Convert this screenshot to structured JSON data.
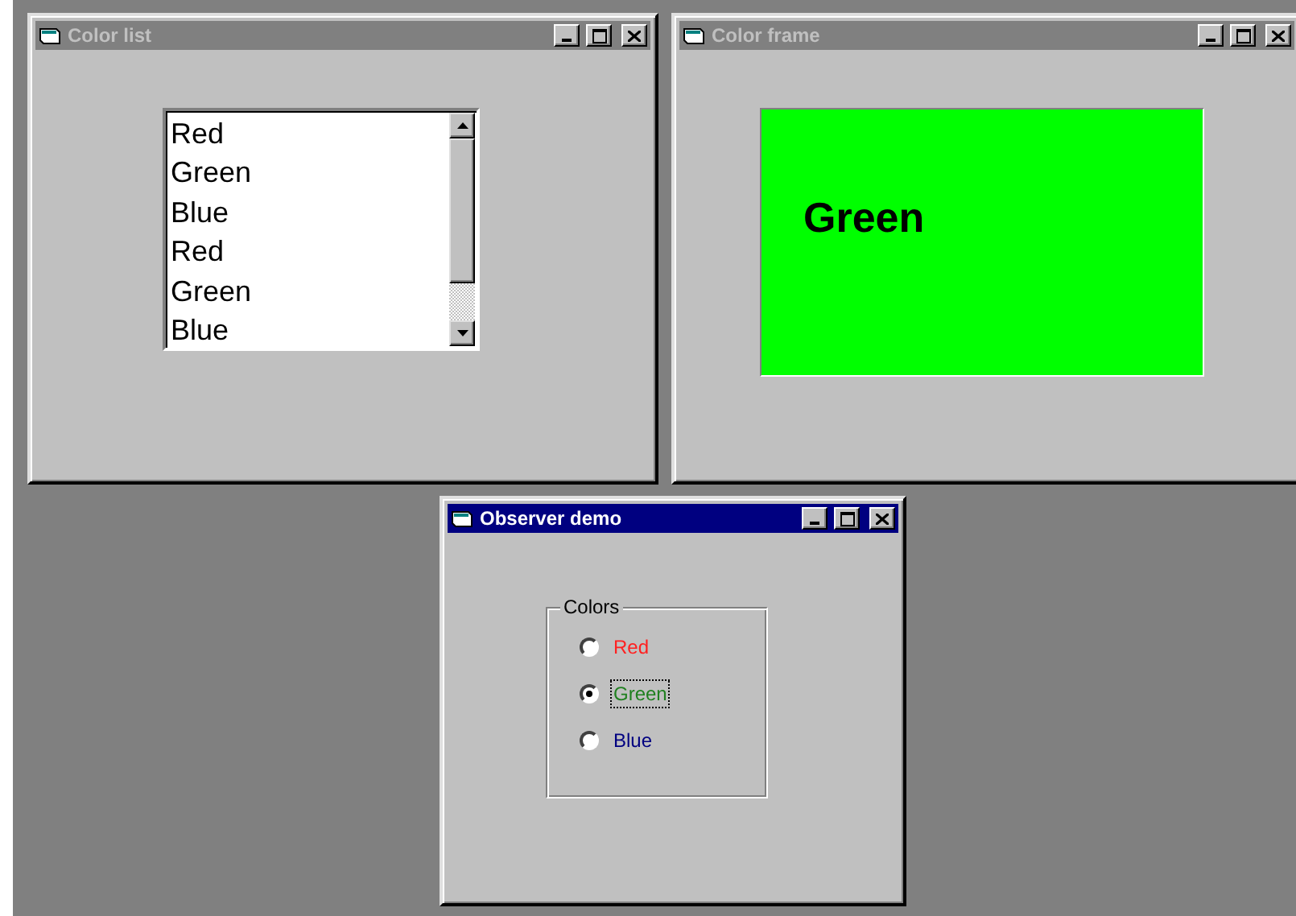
{
  "windows": [
    {
      "title": "Color list",
      "active": false,
      "kind": "list",
      "items": [
        "Red",
        "Green",
        "Blue",
        "Red",
        "Green",
        "Blue"
      ]
    },
    {
      "title": "Color frame",
      "active": false,
      "kind": "frame",
      "frame": {
        "color": "#00ff00",
        "label": "Green"
      }
    },
    {
      "title": "Observer demo",
      "active": true,
      "kind": "radio",
      "group": {
        "label": "Colors",
        "options": [
          {
            "label": "Red",
            "color": "#ff2020",
            "selected": false,
            "focused": false
          },
          {
            "label": "Green",
            "color": "#208020",
            "selected": true,
            "focused": true
          },
          {
            "label": "Blue",
            "color": "#000080",
            "selected": false,
            "focused": false
          }
        ]
      }
    }
  ]
}
